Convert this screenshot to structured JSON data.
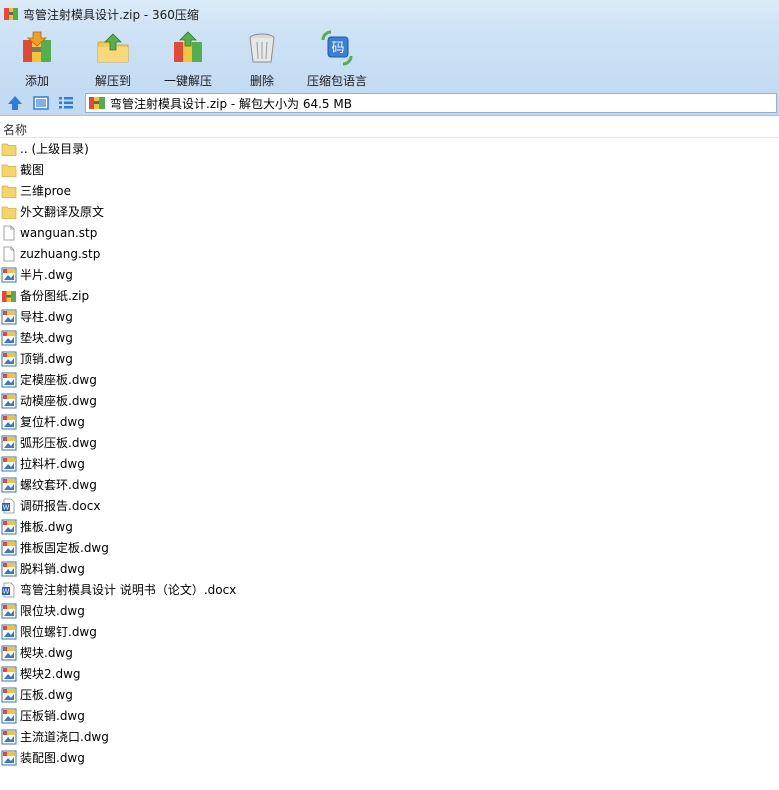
{
  "window": {
    "title": "弯管注射模具设计.zip - 360压缩"
  },
  "toolbar": {
    "add_label": "添加",
    "extract_label": "解压到",
    "oneclick_label": "一键解压",
    "delete_label": "删除",
    "codepage_label": "压缩包语言"
  },
  "pathbar": {
    "text": "弯管注射模具设计.zip - 解包大小为 64.5 MB"
  },
  "columns": {
    "name": "名称"
  },
  "files": [
    {
      "name": ".. (上级目录)",
      "icon": "folder-icon"
    },
    {
      "name": "截图",
      "icon": "folder-icon"
    },
    {
      "name": "三维proe",
      "icon": "folder-icon"
    },
    {
      "name": "外文翻译及原文",
      "icon": "folder-icon"
    },
    {
      "name": "wanguan.stp",
      "icon": "file-icon"
    },
    {
      "name": "zuzhuang.stp",
      "icon": "file-icon"
    },
    {
      "name": "半片.dwg",
      "icon": "dwg-icon"
    },
    {
      "name": "备份图纸.zip",
      "icon": "zip-icon"
    },
    {
      "name": "导柱.dwg",
      "icon": "dwg-icon"
    },
    {
      "name": "垫块.dwg",
      "icon": "dwg-icon"
    },
    {
      "name": "顶销.dwg",
      "icon": "dwg-icon"
    },
    {
      "name": "定模座板.dwg",
      "icon": "dwg-icon"
    },
    {
      "name": "动模座板.dwg",
      "icon": "dwg-icon"
    },
    {
      "name": "复位杆.dwg",
      "icon": "dwg-icon"
    },
    {
      "name": "弧形压板.dwg",
      "icon": "dwg-icon"
    },
    {
      "name": "拉料杆.dwg",
      "icon": "dwg-icon"
    },
    {
      "name": "螺纹套环.dwg",
      "icon": "dwg-icon"
    },
    {
      "name": "调研报告.docx",
      "icon": "docx-icon"
    },
    {
      "name": "推板.dwg",
      "icon": "dwg-icon"
    },
    {
      "name": "推板固定板.dwg",
      "icon": "dwg-icon"
    },
    {
      "name": "脱料销.dwg",
      "icon": "dwg-icon"
    },
    {
      "name": "弯管注射模具设计 说明书（论文）.docx",
      "icon": "docx-icon"
    },
    {
      "name": "限位块.dwg",
      "icon": "dwg-icon"
    },
    {
      "name": "限位螺钉.dwg",
      "icon": "dwg-icon"
    },
    {
      "name": "楔块.dwg",
      "icon": "dwg-icon"
    },
    {
      "name": "楔块2.dwg",
      "icon": "dwg-icon"
    },
    {
      "name": "压板.dwg",
      "icon": "dwg-icon"
    },
    {
      "name": "压板销.dwg",
      "icon": "dwg-icon"
    },
    {
      "name": "主流道浇口.dwg",
      "icon": "dwg-icon"
    },
    {
      "name": "装配图.dwg",
      "icon": "dwg-icon"
    }
  ],
  "colors": {
    "toolbar_bg": "#c3dbf2",
    "title_bg": "#dcecf9",
    "folder": "#f7d467",
    "accent": "#2b7de0"
  }
}
